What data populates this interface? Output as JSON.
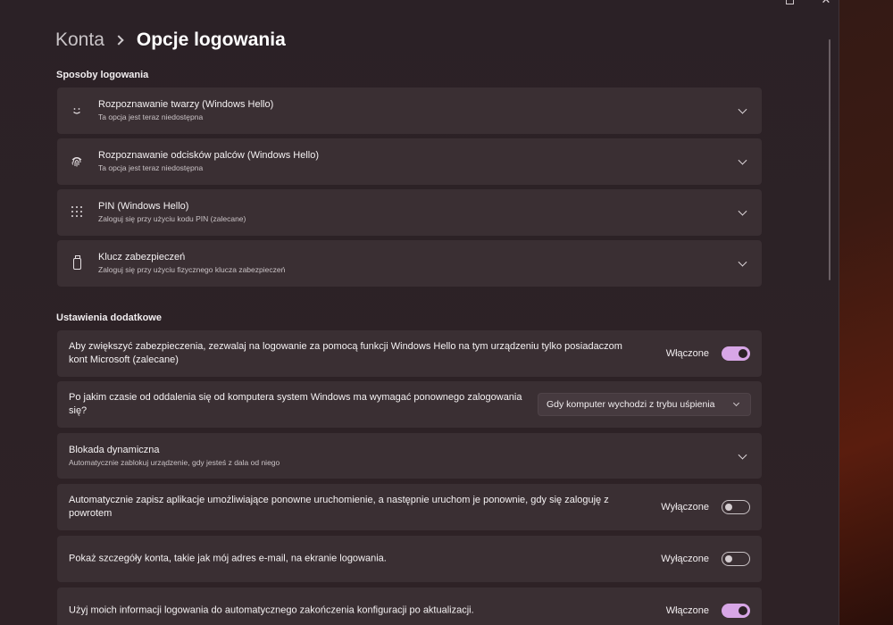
{
  "breadcrumb": {
    "parent": "Konta",
    "current": "Opcje logowania"
  },
  "sections": {
    "methods_title": "Sposoby logowania",
    "additional_title": "Ustawienia dodatkowe"
  },
  "methods": [
    {
      "icon": "face-smile-icon",
      "title": "Rozpoznawanie twarzy (Windows Hello)",
      "subtitle": "Ta opcja jest teraz niedostępna"
    },
    {
      "icon": "fingerprint-icon",
      "title": "Rozpoznawanie odcisków palców (Windows Hello)",
      "subtitle": "Ta opcja jest teraz niedostępna"
    },
    {
      "icon": "pin-keypad-icon",
      "title": "PIN (Windows Hello)",
      "subtitle": "Zaloguj się przy użyciu kodu PIN (zalecane)"
    },
    {
      "icon": "security-key-icon",
      "title": "Klucz zabezpieczeń",
      "subtitle": "Zaloguj się przy użyciu fizycznego klucza zabezpieczeń"
    }
  ],
  "additional": {
    "hello_only": {
      "text": "Aby zwiększyć zabezpieczenia, zezwalaj na logowanie za pomocą funkcji Windows Hello na tym urządzeniu tylko posiadaczom kont Microsoft (zalecane)",
      "state_label": "Włączone",
      "on": true
    },
    "require_signin": {
      "text": "Po jakim czasie od oddalenia się od komputera system Windows ma wymagać ponownego zalogowania się?",
      "dropdown_value": "Gdy komputer wychodzi z trybu uśpienia"
    },
    "dynamic_lock": {
      "title": "Blokada dynamiczna",
      "subtitle": "Automatycznie zablokuj urządzenie, gdy jesteś z dala od niego"
    },
    "restart_apps": {
      "text": "Automatycznie zapisz aplikacje umożliwiające ponowne uruchomienie, a następnie uruchom je ponownie, gdy się zaloguję z powrotem",
      "state_label": "Wyłączone",
      "on": false
    },
    "show_account_details": {
      "text": "Pokaż szczegóły konta, takie jak mój adres e-mail, na ekranie logowania.",
      "state_label": "Wyłączone",
      "on": false
    },
    "use_signin_info": {
      "text": "Użyj moich informacji logowania do automatycznego zakończenia konfiguracji po aktualizacji.",
      "state_label": "Włączone",
      "on": true
    }
  },
  "colors": {
    "accent": "#d7a6e6",
    "card": "#3a2f33",
    "window": "#2c2226"
  }
}
